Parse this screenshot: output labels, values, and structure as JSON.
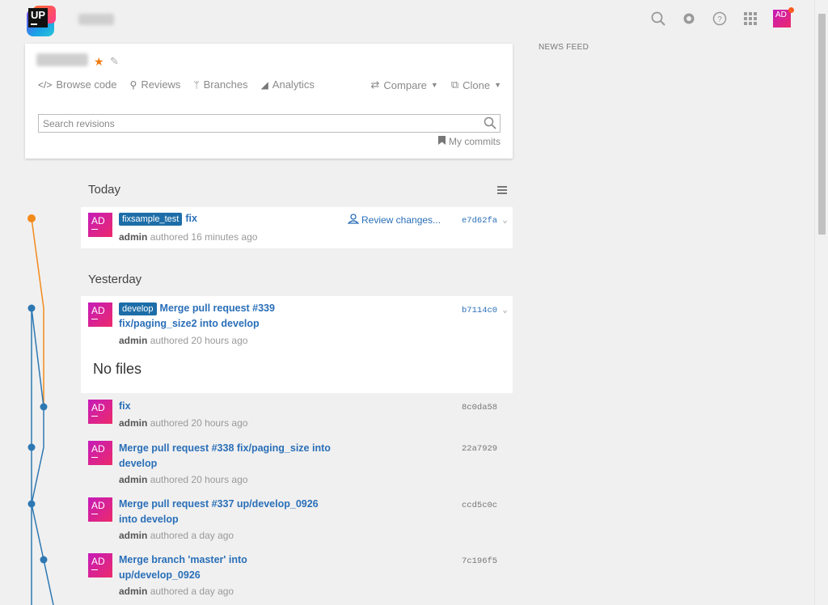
{
  "header": {
    "avatar_initials": "AD",
    "logo_text": "UP"
  },
  "icons": {
    "search": "search-icon",
    "settings": "gear-icon",
    "help": "help-icon",
    "apps": "apps-grid-icon"
  },
  "news_feed": "NEWS FEED",
  "project": {
    "nav": [
      {
        "label": "Browse code",
        "icon": "code-icon"
      },
      {
        "label": "Reviews",
        "icon": "review-icon"
      },
      {
        "label": "Branches",
        "icon": "branch-icon"
      },
      {
        "label": "Analytics",
        "icon": "analytics-icon"
      }
    ],
    "nav_right": [
      {
        "label": "Compare",
        "icon": "compare-icon"
      },
      {
        "label": "Clone",
        "icon": "clone-icon"
      }
    ],
    "search_placeholder": "Search revisions",
    "my_commits": "My commits"
  },
  "sections": {
    "today": "Today",
    "yesterday": "Yesterday"
  },
  "commits": [
    {
      "initials": "AD",
      "branch": "fixsample_test",
      "title": "fix",
      "author": "admin",
      "time": "authored 16 minutes ago",
      "hash": "e7d62fa",
      "review": "Review changes..."
    },
    {
      "initials": "AD",
      "branch": "develop",
      "title": "Merge pull request #339 fix/paging_size2 into develop",
      "author": "admin",
      "time": "authored 20 hours ago",
      "hash": "b7114c0",
      "no_files": "No files"
    },
    {
      "initials": "AD",
      "title": "fix",
      "author": "admin",
      "time": "authored 20 hours ago",
      "hash": "8c0da58"
    },
    {
      "initials": "AD",
      "title": "Merge pull request #338 fix/paging_size into develop",
      "author": "admin",
      "time": "authored 20 hours ago",
      "hash": "22a7929"
    },
    {
      "initials": "AD",
      "title": "Merge pull request #337 up/develop_0926 into develop",
      "author": "admin",
      "time": "authored a day ago",
      "hash": "ccd5c0c"
    },
    {
      "initials": "AD",
      "title": "Merge branch 'master' into up/develop_0926",
      "author": "admin",
      "time": "authored a day ago",
      "hash": "7c196f5"
    }
  ],
  "colors": {
    "accent": "#2a6fb8",
    "badge": "#1d6ea8",
    "graph_orange": "#f28a1a",
    "graph_blue": "#2d78b3"
  }
}
